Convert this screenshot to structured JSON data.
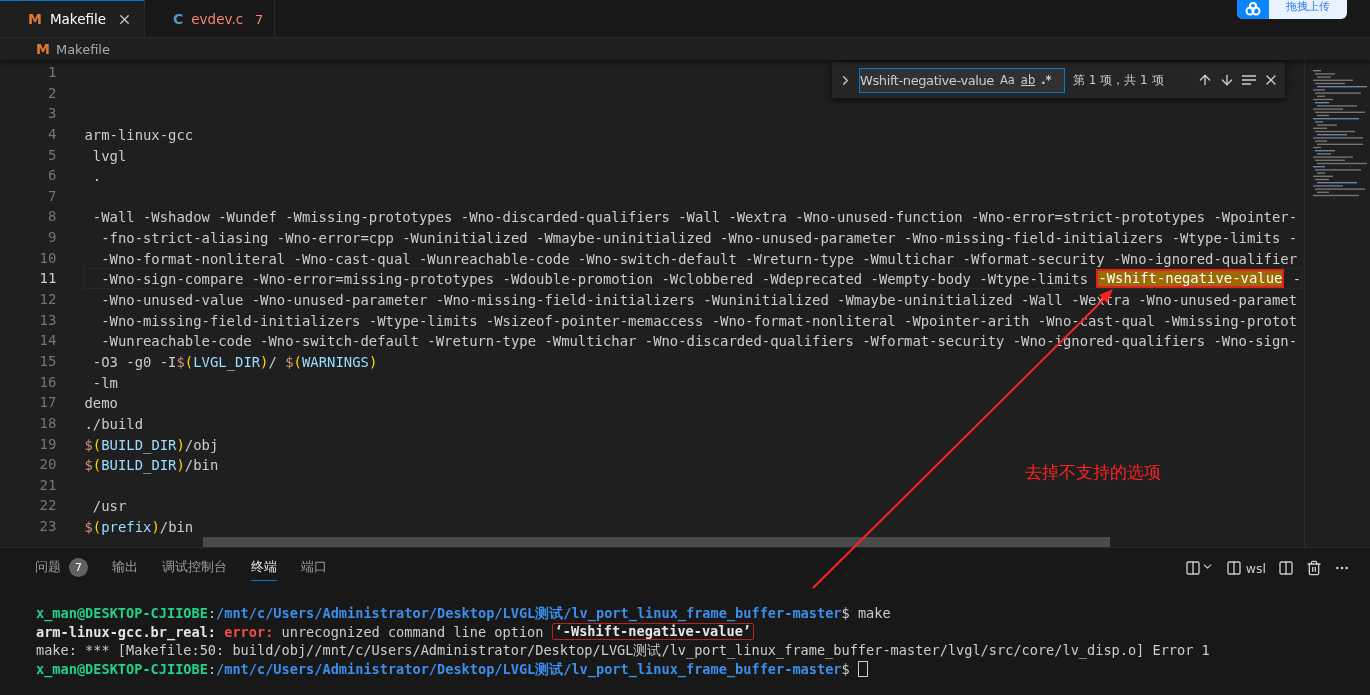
{
  "tabs": [
    {
      "icon": "M",
      "kind": "makefile",
      "label": "Makefile",
      "selected": true,
      "error": false
    },
    {
      "icon": "C",
      "kind": "c",
      "label": "evdev.c",
      "selected": false,
      "modified_count": "7",
      "error": true
    }
  ],
  "upload_widget": {
    "label": "拖拽上传"
  },
  "breadcrumb": {
    "icon": "M",
    "label": "Makefile"
  },
  "find_widget": {
    "value": "Wshift-negative-value",
    "toggles": [
      "Aa",
      "ab",
      ".*"
    ],
    "result": "第 1 项，共 1 项"
  },
  "code_lines": [
    {
      "number": "1",
      "current": false
    },
    {
      "number": "2",
      "current": false
    },
    {
      "number": "3",
      "current": false
    },
    {
      "number": "4",
      "current": false,
      "tokens": [
        {
          "kind": "text",
          "text": "arm-linux-gcc"
        }
      ]
    },
    {
      "number": "5",
      "current": false,
      "tokens": [
        {
          "kind": "text",
          "text": " lvgl"
        }
      ]
    },
    {
      "number": "6",
      "current": false,
      "tokens": [
        {
          "kind": "text",
          "text": " ."
        }
      ]
    },
    {
      "number": "7",
      "current": false
    },
    {
      "number": "8",
      "current": false,
      "tokens": [
        {
          "kind": "text",
          "text": " -Wall -Wshadow -Wundef -Wmissing-prototypes -Wno-discarded-qualifiers -Wall -Wextra -Wno-unused-function -Wno-error=strict-prototypes -Wpointer-"
        }
      ]
    },
    {
      "number": "9",
      "current": false,
      "tokens": [
        {
          "kind": "text",
          "text": "  -fno-strict-aliasing -Wno-error=cpp -Wuninitialized -Wmaybe-uninitialized -Wno-unused-parameter -Wno-missing-field-initializers -Wtype-limits -"
        }
      ]
    },
    {
      "number": "10",
      "current": false,
      "tokens": [
        {
          "kind": "text",
          "text": "  -Wno-format-nonliteral -Wno-cast-qual -Wunreachable-code -Wno-switch-default -Wreturn-type -Wmultichar -Wformat-security -Wno-ignored-qualifier"
        }
      ]
    },
    {
      "number": "11",
      "current": true,
      "tokens": [
        {
          "kind": "text",
          "text": "  -Wno-sign-compare -Wno-error=missing-prototypes -Wdouble-promotion -Wclobbered -Wdeprecated -Wempty-body -Wtype-limits "
        },
        {
          "kind": "match",
          "text": "-Wshift-negative-value",
          "boxed": true
        },
        {
          "kind": "text",
          "text": " -"
        }
      ]
    },
    {
      "number": "12",
      "current": false,
      "tokens": [
        {
          "kind": "text",
          "text": "  -Wno-unused-value -Wno-unused-parameter -Wno-missing-field-initializers -Wuninitialized -Wmaybe-uninitialized -Wall -Wextra -Wno-unused-paramet"
        }
      ]
    },
    {
      "number": "13",
      "current": false,
      "tokens": [
        {
          "kind": "text",
          "text": "  -Wno-missing-field-initializers -Wtype-limits -Wsizeof-pointer-memaccess -Wno-format-nonliteral -Wpointer-arith -Wno-cast-qual -Wmissing-protot"
        }
      ]
    },
    {
      "number": "14",
      "current": false,
      "tokens": [
        {
          "kind": "text",
          "text": "  -Wunreachable-code -Wno-switch-default -Wreturn-type -Wmultichar -Wno-discarded-qualifiers -Wformat-security -Wno-ignored-qualifiers -Wno-sign-"
        }
      ]
    },
    {
      "number": "15",
      "current": false,
      "tokens": [
        {
          "kind": "text",
          "text": " -O3 -g0 -I"
        },
        {
          "kind": "sigil",
          "text": "$"
        },
        {
          "kind": "bracket",
          "text": "("
        },
        {
          "kind": "variable",
          "text": "LVGL_DIR"
        },
        {
          "kind": "bracket",
          "text": ")"
        },
        {
          "kind": "text",
          "text": "/ "
        },
        {
          "kind": "sigil",
          "text": "$"
        },
        {
          "kind": "bracket",
          "text": "("
        },
        {
          "kind": "variable",
          "text": "WARNINGS"
        },
        {
          "kind": "bracket",
          "text": ")"
        }
      ]
    },
    {
      "number": "16",
      "current": false,
      "tokens": [
        {
          "kind": "text",
          "text": " -lm"
        }
      ]
    },
    {
      "number": "17",
      "current": false,
      "tokens": [
        {
          "kind": "text",
          "text": "demo"
        }
      ]
    },
    {
      "number": "18",
      "current": false,
      "tokens": [
        {
          "kind": "text",
          "text": "./build"
        }
      ]
    },
    {
      "number": "19",
      "current": false,
      "tokens": [
        {
          "kind": "sigil",
          "text": "$"
        },
        {
          "kind": "bracket",
          "text": "("
        },
        {
          "kind": "variable",
          "text": "BUILD_DIR"
        },
        {
          "kind": "bracket",
          "text": ")"
        },
        {
          "kind": "text",
          "text": "/obj"
        }
      ]
    },
    {
      "number": "20",
      "current": false,
      "tokens": [
        {
          "kind": "sigil",
          "text": "$"
        },
        {
          "kind": "bracket",
          "text": "("
        },
        {
          "kind": "variable",
          "text": "BUILD_DIR"
        },
        {
          "kind": "bracket",
          "text": ")"
        },
        {
          "kind": "text",
          "text": "/bin"
        }
      ]
    },
    {
      "number": "21",
      "current": false
    },
    {
      "number": "22",
      "current": false,
      "tokens": [
        {
          "kind": "text",
          "text": " /usr"
        }
      ]
    },
    {
      "number": "23",
      "current": false,
      "tokens": [
        {
          "kind": "sigil",
          "text": "$"
        },
        {
          "kind": "bracket",
          "text": "("
        },
        {
          "kind": "variable",
          "text": "prefix"
        },
        {
          "kind": "bracket",
          "text": ")"
        },
        {
          "kind": "text",
          "text": "/bin"
        }
      ]
    }
  ],
  "annotation": {
    "text": "去掉不支持的选项"
  },
  "panel": {
    "tabs": [
      {
        "label": "问题",
        "badge": "7",
        "selected": false
      },
      {
        "label": "输出",
        "selected": false
      },
      {
        "label": "调试控制台",
        "selected": false
      },
      {
        "label": "终端",
        "selected": true
      },
      {
        "label": "端口",
        "selected": false
      }
    ],
    "terminal_profile": "wsl",
    "terminal_lines": [
      {
        "tokens": [
          {
            "kind": "user",
            "text": "x_man@DESKTOP-CJIIOBE"
          },
          {
            "kind": "plain",
            "text": ":"
          },
          {
            "kind": "path",
            "text": "/mnt/c/Users/Administrator/Desktop/LVGL测试/lv_port_linux_frame_buffer-master"
          },
          {
            "kind": "plain",
            "text": "$ make"
          }
        ]
      },
      {
        "tokens": [
          {
            "kind": "bold",
            "text": "arm-linux-gcc.br_real: "
          },
          {
            "kind": "error",
            "text": "error:"
          },
          {
            "kind": "plain",
            "text": " unrecognized command line option "
          },
          {
            "kind": "bold",
            "text": "‘-Wshift-negative-value’",
            "boxed": true
          }
        ]
      },
      {
        "tokens": [
          {
            "kind": "plain",
            "text": "make: *** [Makefile:50: build/obj//mnt/c/Users/Administrator/Desktop/LVGL测试/lv_port_linux_frame_buffer-master/lvgl/src/core/lv_disp.o] Error 1"
          }
        ]
      },
      {
        "tokens": [
          {
            "kind": "user",
            "text": "x_man@DESKTOP-CJIIOBE"
          },
          {
            "kind": "plain",
            "text": ":"
          },
          {
            "kind": "path",
            "text": "/mnt/c/Users/Administrator/Desktop/LVGL测试/lv_port_linux_frame_buffer-master"
          },
          {
            "kind": "plain",
            "text": "$"
          },
          {
            "kind": "cursor"
          }
        ]
      }
    ]
  }
}
